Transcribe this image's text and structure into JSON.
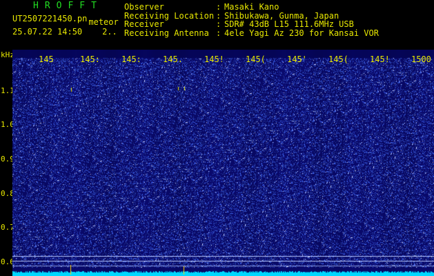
{
  "header": {
    "title": "HROFFT",
    "file_name": "UT2507221450.pn",
    "file_suffix": "meteor",
    "datetime": "25.07.22 14:50",
    "extra": "2..",
    "info": [
      {
        "label": "Observer",
        "value": "Masaki Kano"
      },
      {
        "label": "Receiving Location",
        "value": "Shibukawa, Gunma, Japan"
      },
      {
        "label": "Receiver",
        "value": "SDR# 43dB L15 111.6MHz USB"
      },
      {
        "label": "Receiving Antenna",
        "value": "4ele Yagi Az 230 for Kansai VOR"
      }
    ]
  },
  "spectrogram": {
    "y_unit": "kHz",
    "x_ticks": [
      "145",
      "145:",
      "145:",
      "145.",
      "145!",
      "145(",
      "145'",
      "145(",
      "145!",
      "1500"
    ],
    "y_ticks": [
      "1.1",
      "1.0",
      "0.9",
      "0.8",
      "0.7",
      "0.6"
    ],
    "colors": {
      "background": "#0a0a6e",
      "noise": "#3a56ff",
      "label": "#e8e800",
      "trace": "#00d8ff"
    }
  }
}
